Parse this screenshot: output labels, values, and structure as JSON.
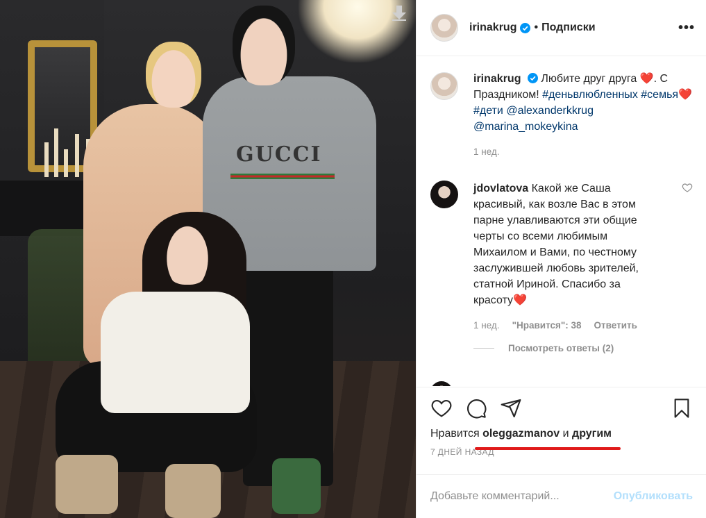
{
  "post": {
    "author": "irinakrug",
    "follow_label": "Подписки",
    "separator": "•",
    "more_label": "•••",
    "verified": true,
    "accent_color": "#0095f6"
  },
  "photo": {
    "print_text": "GUCCI",
    "download_icon": "download-arrow-icon"
  },
  "caption": {
    "author": "irinakrug",
    "text_1": "Любите друг друга",
    "emoji_1": "❤️",
    "text_2": ". С Праздником! ",
    "tag_1": "#деньвлюбленных",
    "tag_2": "#семья",
    "emoji_2": "❤️",
    "tag_3": "#дети",
    "mention_1": "@alexanderkkrug",
    "mention_2": "@marina_mokeykina",
    "time": "1 нед."
  },
  "comment": {
    "author": "jdovlatova",
    "text": "Какой же Саша красивый, как возле Вас в этом парне улавливаются эти общие черты со всеми любимым Михаилом и Вами, по честному заслужившей любовь зрителей, статной Ириной. Спасибо за красоту",
    "emoji": "❤️",
    "time": "1 нед.",
    "likes": "\"Нравится\": 38",
    "reply_label": "Ответить",
    "view_replies": "Посмотреть ответы (2)"
  },
  "actions": {
    "icons": [
      "heart-icon",
      "comment-icon",
      "share-icon",
      "bookmark-icon"
    ],
    "likes_prefix": "Нравится",
    "likes_user": "oleggazmanov",
    "likes_and": "и",
    "likes_others": "другим",
    "date": "7 ДНЕЙ НАЗАД"
  },
  "add_comment": {
    "placeholder": "Добавьте комментарий...",
    "publish_label": "Опубликовать"
  }
}
